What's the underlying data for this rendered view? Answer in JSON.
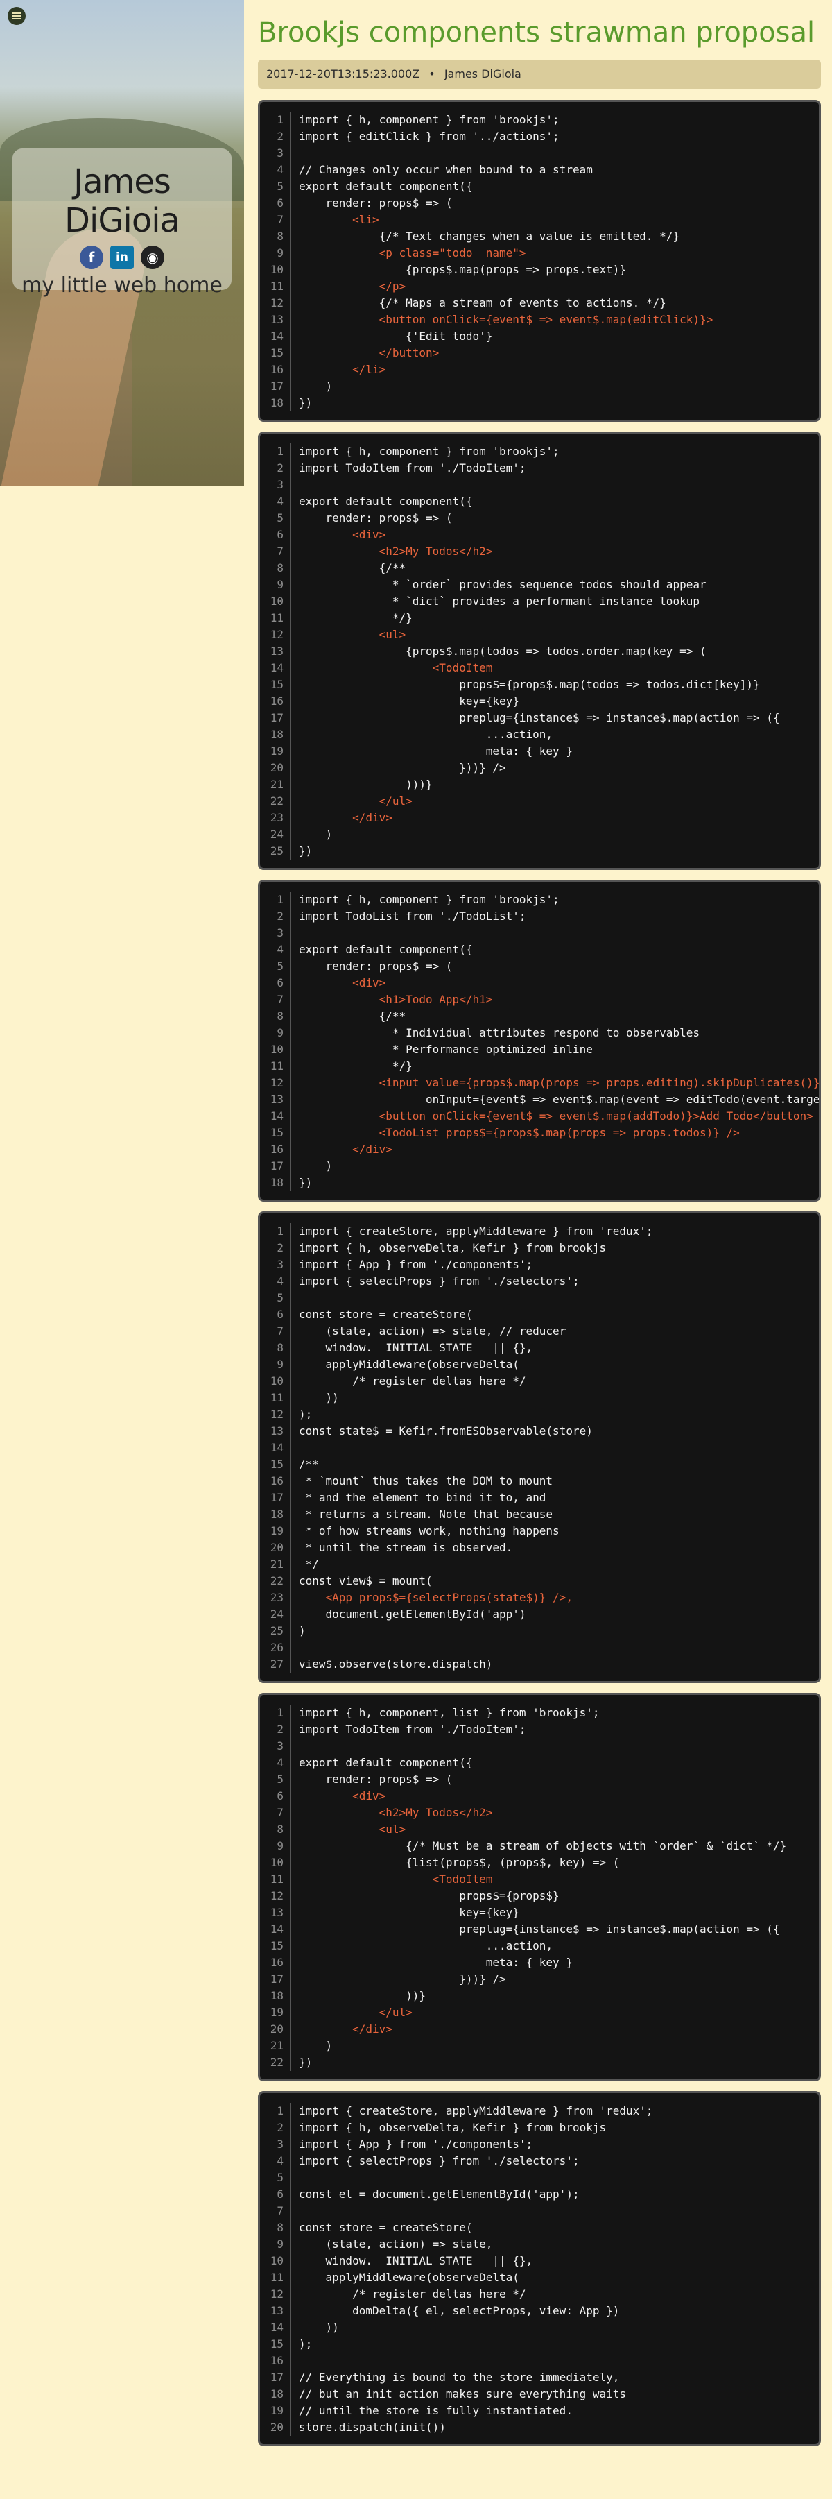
{
  "sidebar": {
    "name": "James DiGioia",
    "tagline": "my little web home",
    "socials": [
      {
        "icon": "facebook-icon",
        "glyph": "f"
      },
      {
        "icon": "linkedin-icon",
        "glyph": "in"
      },
      {
        "icon": "github-icon",
        "glyph": "◉"
      }
    ]
  },
  "post": {
    "title": "Brookjs components strawman proposal",
    "date": "2017-12-20T13:15:23.000Z",
    "bullet": "•",
    "author": "James DiGioia"
  },
  "code_blocks": [
    {
      "lines": [
        "import { h, component } from 'brookjs';",
        "import { editClick } from '../actions';",
        "",
        "// Changes only occur when bound to a stream",
        "export default component({",
        "    render: props$ => (",
        "        <li>",
        "            {/* Text changes when a value is emitted. */}",
        "            <p class=\"todo__name\">",
        "                {props$.map(props => props.text)}",
        "            </p>",
        "            {/* Maps a stream of events to actions. */}",
        "            <button onClick={event$ => event$.map(editClick)}>",
        "                {'Edit todo'}",
        "            </button>",
        "        </li>",
        "    )",
        "})"
      ]
    },
    {
      "lines": [
        "import { h, component } from 'brookjs';",
        "import TodoItem from './TodoItem';",
        "",
        "export default component({",
        "    render: props$ => (",
        "        <div>",
        "            <h2>My Todos</h2>",
        "            {/**",
        "              * `order` provides sequence todos should appear",
        "              * `dict` provides a performant instance lookup",
        "              */}",
        "            <ul>",
        "                {props$.map(todos => todos.order.map(key => (",
        "                    <TodoItem",
        "                        props$={props$.map(todos => todos.dict[key])}",
        "                        key={key}",
        "                        preplug={instance$ => instance$.map(action => ({",
        "                            ...action,",
        "                            meta: { key }",
        "                        }))} />",
        "                )))}",
        "            </ul>",
        "        </div>",
        "    )",
        "})"
      ]
    },
    {
      "lines": [
        "import { h, component } from 'brookjs';",
        "import TodoList from './TodoList';",
        "",
        "export default component({",
        "    render: props$ => (",
        "        <div>",
        "            <h1>Todo App</h1>",
        "            {/**",
        "              * Individual attributes respond to observables",
        "              * Performance optimized inline",
        "              */}",
        "            <input value={props$.map(props => props.editing).skipDuplicates()}",
        "                   onInput={event$ => event$.map(event => editTodo(event.target.value))} />",
        "            <button onClick={event$ => event$.map(addTodo)}>Add Todo</button>",
        "            <TodoList props$={props$.map(props => props.todos)} />",
        "        </div>",
        "    )",
        "})"
      ]
    },
    {
      "lines": [
        "import { createStore, applyMiddleware } from 'redux';",
        "import { h, observeDelta, Kefir } from brookjs",
        "import { App } from './components';",
        "import { selectProps } from './selectors';",
        "",
        "const store = createStore(",
        "    (state, action) => state, // reducer",
        "    window.__INITIAL_STATE__ || {},",
        "    applyMiddleware(observeDelta(",
        "        /* register deltas here */",
        "    ))",
        ");",
        "const state$ = Kefir.fromESObservable(store)",
        "",
        "/**",
        " * `mount` thus takes the DOM to mount",
        " * and the element to bind it to, and",
        " * returns a stream. Note that because",
        " * of how streams work, nothing happens",
        " * until the stream is observed.",
        " */",
        "const view$ = mount(",
        "    <App props$={selectProps(state$)} />,",
        "    document.getElementById('app')",
        ")",
        "",
        "view$.observe(store.dispatch)"
      ]
    },
    {
      "lines": [
        "import { h, component, list } from 'brookjs';",
        "import TodoItem from './TodoItem';",
        "",
        "export default component({",
        "    render: props$ => (",
        "        <div>",
        "            <h2>My Todos</h2>",
        "            <ul>",
        "                {/* Must be a stream of objects with `order` & `dict` */}",
        "                {list(props$, (props$, key) => (",
        "                    <TodoItem",
        "                        props$={props$}",
        "                        key={key}",
        "                        preplug={instance$ => instance$.map(action => ({",
        "                            ...action,",
        "                            meta: { key }",
        "                        }))} />",
        "                ))}",
        "            </ul>",
        "        </div>",
        "    )",
        "})"
      ]
    },
    {
      "lines": [
        "import { createStore, applyMiddleware } from 'redux';",
        "import { h, observeDelta, Kefir } from brookjs",
        "import { App } from './components';",
        "import { selectProps } from './selectors';",
        "",
        "const el = document.getElementById('app');",
        "",
        "const store = createStore(",
        "    (state, action) => state,",
        "    window.__INITIAL_STATE__ || {},",
        "    applyMiddleware(observeDelta(",
        "        /* register deltas here */",
        "        domDelta({ el, selectProps, view: App })",
        "    ))",
        ");",
        "",
        "// Everything is bound to the store immediately,",
        "// but an init action makes sure everything waits",
        "// until the store is fully instantiated.",
        "store.dispatch(init())"
      ]
    }
  ]
}
